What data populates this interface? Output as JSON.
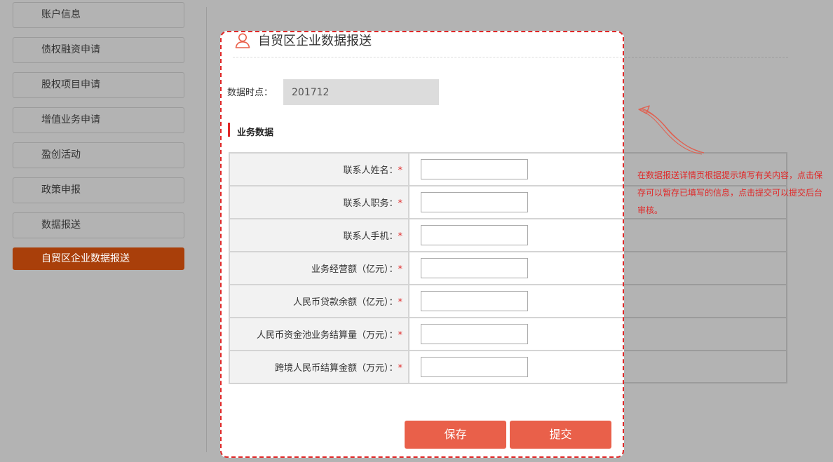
{
  "sidebar": {
    "items": [
      {
        "label": "账户信息"
      },
      {
        "label": "债权融资申请"
      },
      {
        "label": "股权项目申请"
      },
      {
        "label": "增值业务申请"
      },
      {
        "label": "盈创活动"
      },
      {
        "label": "政策申报"
      },
      {
        "label": "数据报送"
      },
      {
        "label": "自贸区企业数据报送",
        "active": true
      }
    ]
  },
  "modal": {
    "title": "自贸区企业数据报送",
    "data_time_label": "数据时点：",
    "data_time_value": "201712",
    "section_title": "业务数据",
    "fields": [
      {
        "label": "联系人姓名：",
        "required": "*",
        "value": ""
      },
      {
        "label": "联系人职务：",
        "required": "*",
        "value": ""
      },
      {
        "label": "联系人手机：",
        "required": "*",
        "value": ""
      },
      {
        "label": "业务经营额（亿元）：",
        "required": "*",
        "value": ""
      },
      {
        "label": "人民币贷款余额（亿元）：",
        "required": "*",
        "value": ""
      },
      {
        "label": "人民币资金池业务结算量（万元）：",
        "required": "*",
        "value": ""
      },
      {
        "label": "跨境人民币结算金额（万元）：",
        "required": "*",
        "value": ""
      }
    ],
    "save_label": "保存",
    "submit_label": "提交"
  },
  "annotation": {
    "text": "在数据报送详情页根据提示填写有关内容，点击保存可以暂存已填写的信息，点击提交可以提交后台审核。"
  },
  "colors": {
    "active_nav": "#a93f0a",
    "accent_red": "#e02828",
    "button": "#e9604a",
    "overlay": "#b3b3b3"
  },
  "icons": {
    "modal_title": "user-icon",
    "annotation_pointer": "arrow-icon"
  }
}
